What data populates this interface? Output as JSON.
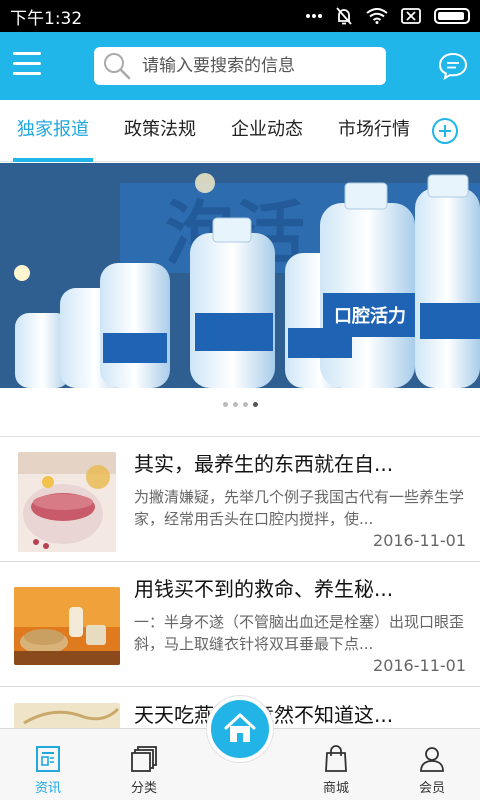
{
  "statusbar": {
    "time": "下午1:32",
    "icons": [
      "more-dots-icon",
      "notifications-off-icon",
      "wifi-icon",
      "no-sim-icon",
      "battery-icon"
    ]
  },
  "header": {
    "menu_icon": "hamburger-menu-icon",
    "search_placeholder": "请输入要搜索的信息",
    "search_icon": "search-icon",
    "chat_icon": "chat-bubble-icon",
    "background": "#21b6ea"
  },
  "tabs": [
    {
      "label": "独家报道",
      "active": true
    },
    {
      "label": "政策法规",
      "active": false
    },
    {
      "label": "企业动态",
      "active": false
    },
    {
      "label": "市场行情",
      "active": false
    }
  ],
  "tab_add_icon": "plus-circle-icon",
  "banner": {
    "caption": "",
    "bottle_label": "口腔活力",
    "dots": 4,
    "active_dot": 3
  },
  "news": [
    {
      "title": "其实，最养生的东西就在自...",
      "summary": "为撇清嫌疑，先举几个例子我国古代有一些养生学家，经常用舌头在口腔内搅拌，使...",
      "date": "2016-11-01"
    },
    {
      "title": "用钱买不到的救命、养生秘...",
      "summary": "一：半身不遂（不管脑出血还是栓塞）出现口眼歪斜，马上取缝衣针将双耳垂最下点...",
      "date": "2016-11-01"
    },
    {
      "title": "天天吃燕麦，竟然不知道这...",
      "summary": "",
      "date": ""
    }
  ],
  "bottomnav": {
    "items": [
      {
        "label": "资讯",
        "icon": "news-icon",
        "active": true
      },
      {
        "label": "分类",
        "icon": "category-icon",
        "active": false
      },
      {
        "label": "商城",
        "icon": "shopping-bag-icon",
        "active": false
      },
      {
        "label": "会员",
        "icon": "user-icon",
        "active": false
      }
    ],
    "home_icon": "home-icon"
  },
  "colors": {
    "accent": "#21b6ea",
    "active_tab_text": "#21a8df",
    "date": "#666666"
  }
}
